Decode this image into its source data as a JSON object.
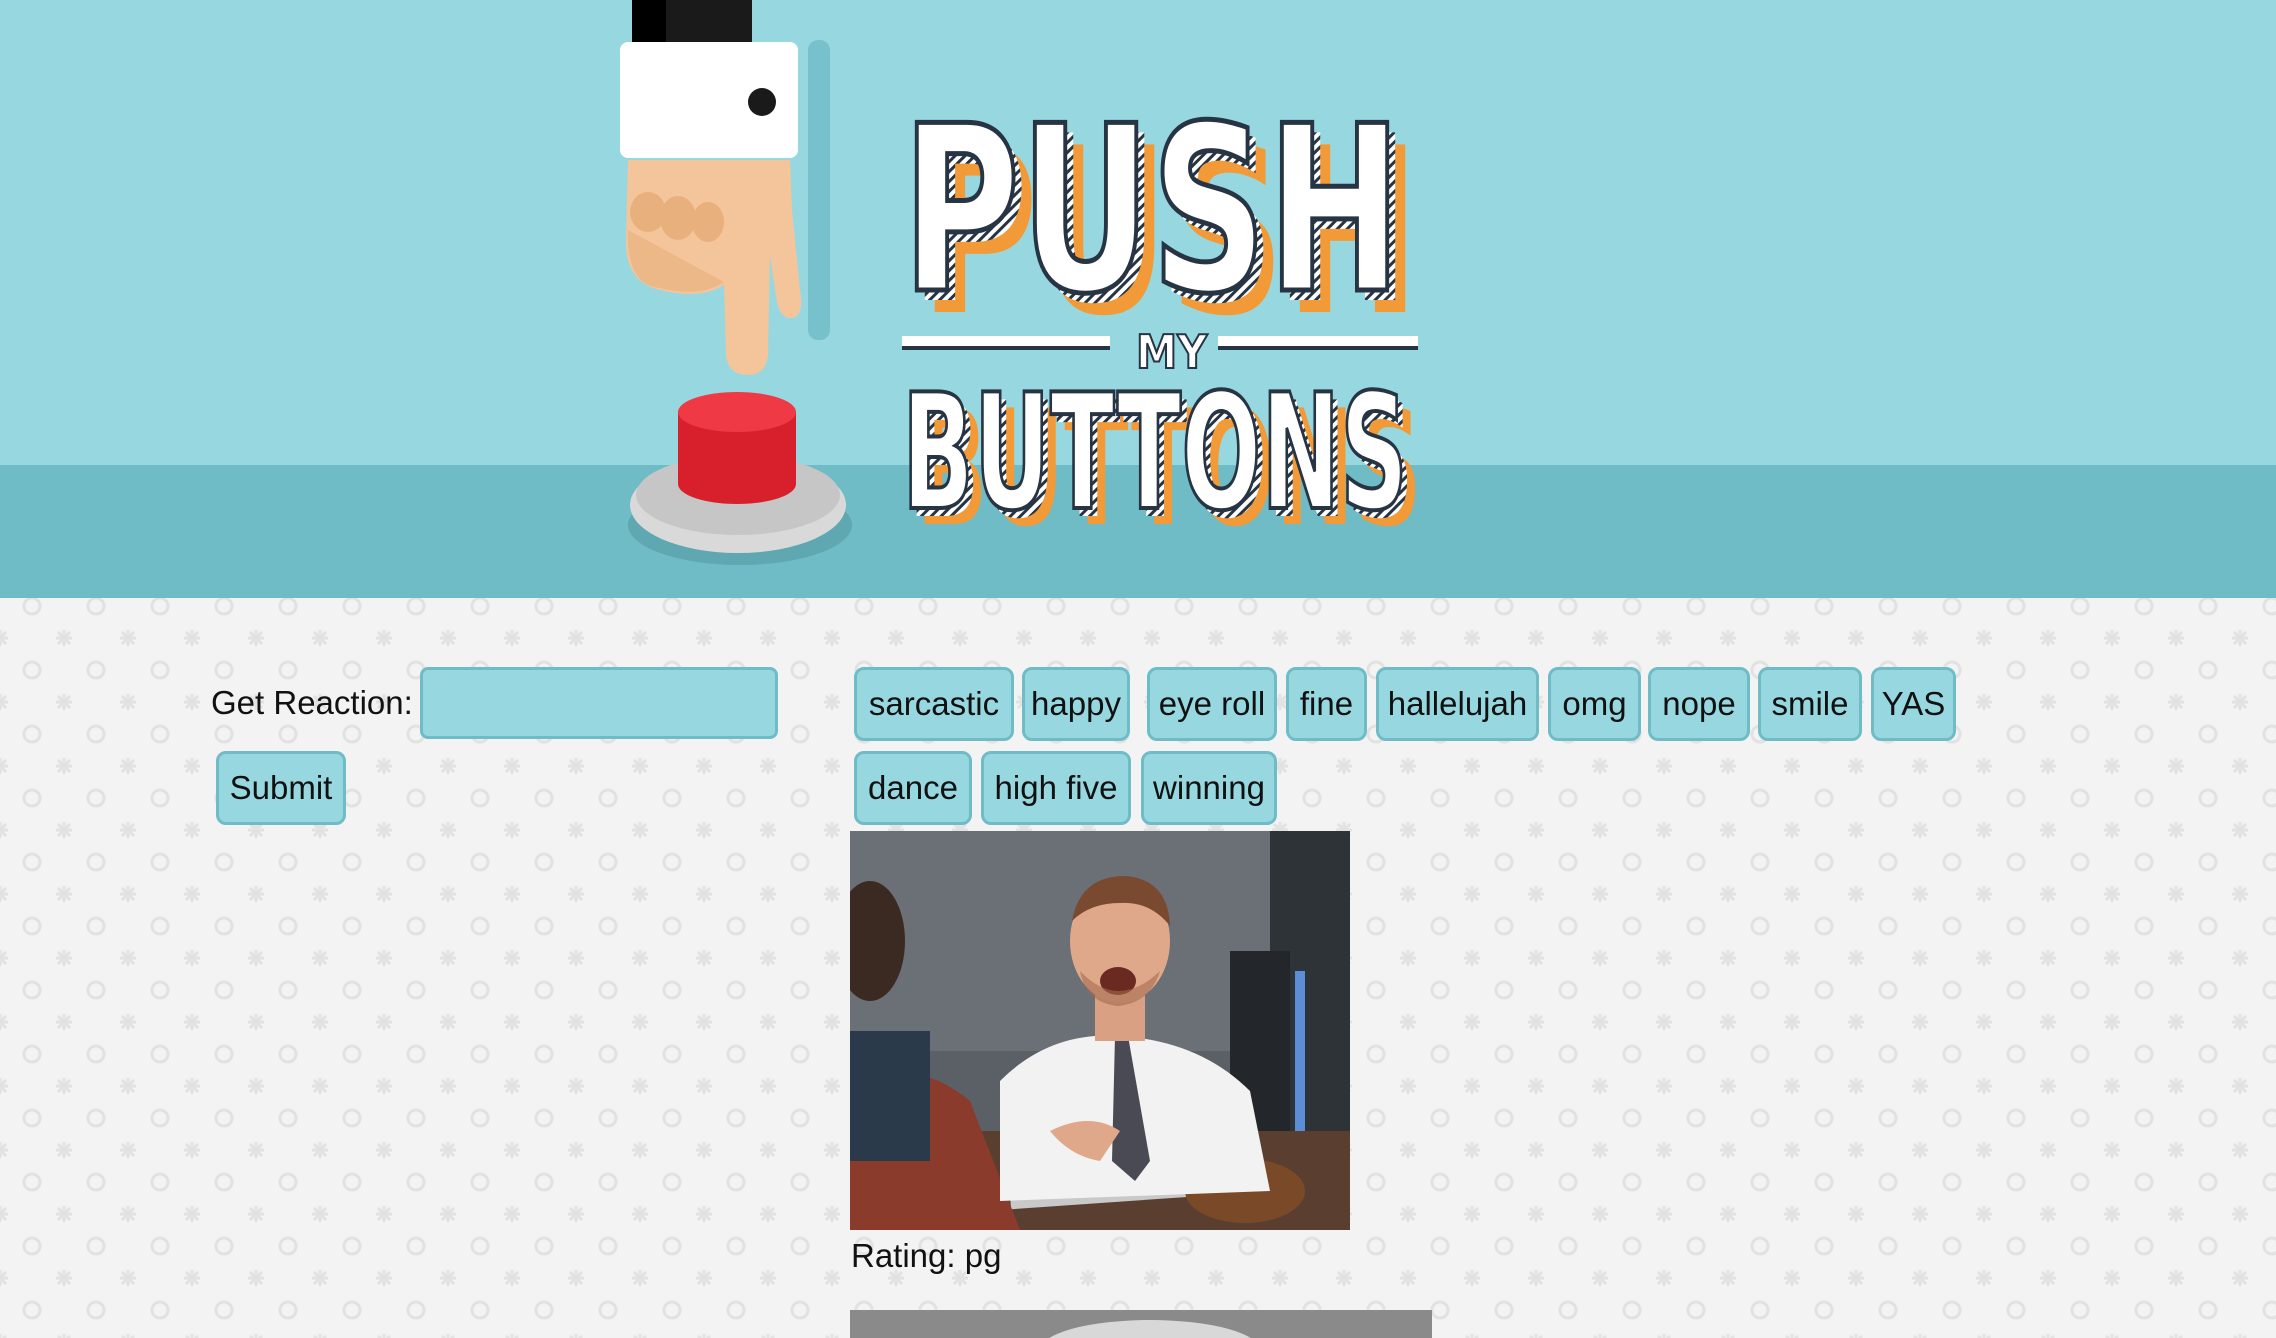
{
  "header": {
    "logo_line1": "PUSH",
    "logo_line2": "MY",
    "logo_line3": "BUTTONS"
  },
  "form": {
    "label": "Get Reaction:",
    "input_value": "",
    "submit_label": "Submit"
  },
  "topics": [
    "sarcastic",
    "happy",
    "eye roll",
    "fine",
    "hallelujah",
    "omg",
    "nope",
    "smile",
    "YAS",
    "dance",
    "high five",
    "winning"
  ],
  "results": [
    {
      "rating_text": "Rating: pg"
    }
  ],
  "colors": {
    "banner_sky": "#97d8e0",
    "banner_floor": "#6fbcc7",
    "button_fill": "#97d8e0",
    "button_border": "#6fbcc7",
    "logo_orange": "#f29a38",
    "logo_navy": "#273444",
    "push_button_red": "#e42f3b"
  }
}
